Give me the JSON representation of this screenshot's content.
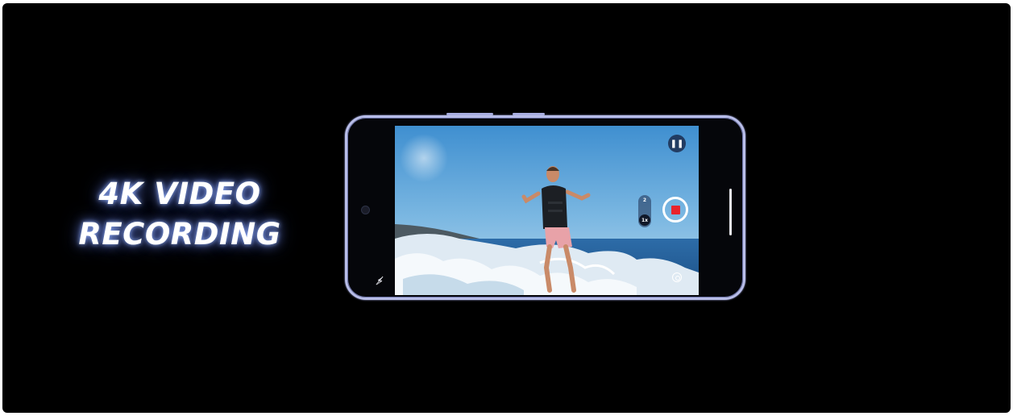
{
  "promo": {
    "headline_line1": "4K VIDEO",
    "headline_line2": "RECORDING"
  },
  "camera": {
    "mode": "video",
    "recording": true,
    "zoom_options": [
      "2",
      "1x"
    ],
    "zoom_selected": "1x",
    "pause_icon": "pause-icon",
    "pause_glyph": "❚❚",
    "flash_glyph": "⚡̸",
    "stop_color": "#e8232c"
  },
  "colors": {
    "background": "#000000",
    "phone_frame": "#b8bde8",
    "glow": "#8ca6ff"
  }
}
